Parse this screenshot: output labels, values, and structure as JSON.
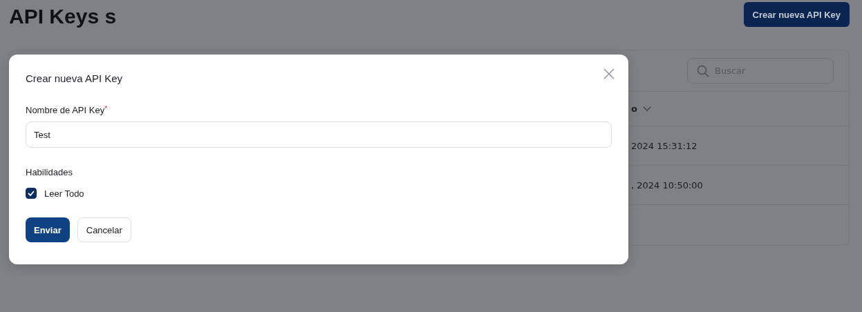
{
  "page": {
    "title": "API Keys s",
    "create_button": "Crear nueva API Key"
  },
  "table": {
    "search": {
      "placeholder": "Buscar"
    },
    "column_1": "o",
    "rows": [
      {
        "column_1": "2024 15:31:12"
      },
      {
        "column_1": ", 2024 10:50:00"
      }
    ]
  },
  "modal": {
    "title": "Crear nueva API Key",
    "name_label": "Nombre de API Key",
    "required_mark": "*",
    "name_value": "Test",
    "abilities_label": "Habilidades",
    "abilities": [
      {
        "label": "Leer Todo",
        "checked": true
      }
    ],
    "buttons": [
      {
        "label": "Enviar",
        "kind": "primary"
      },
      {
        "label": "Cancelar",
        "kind": "secondary"
      }
    ]
  }
}
